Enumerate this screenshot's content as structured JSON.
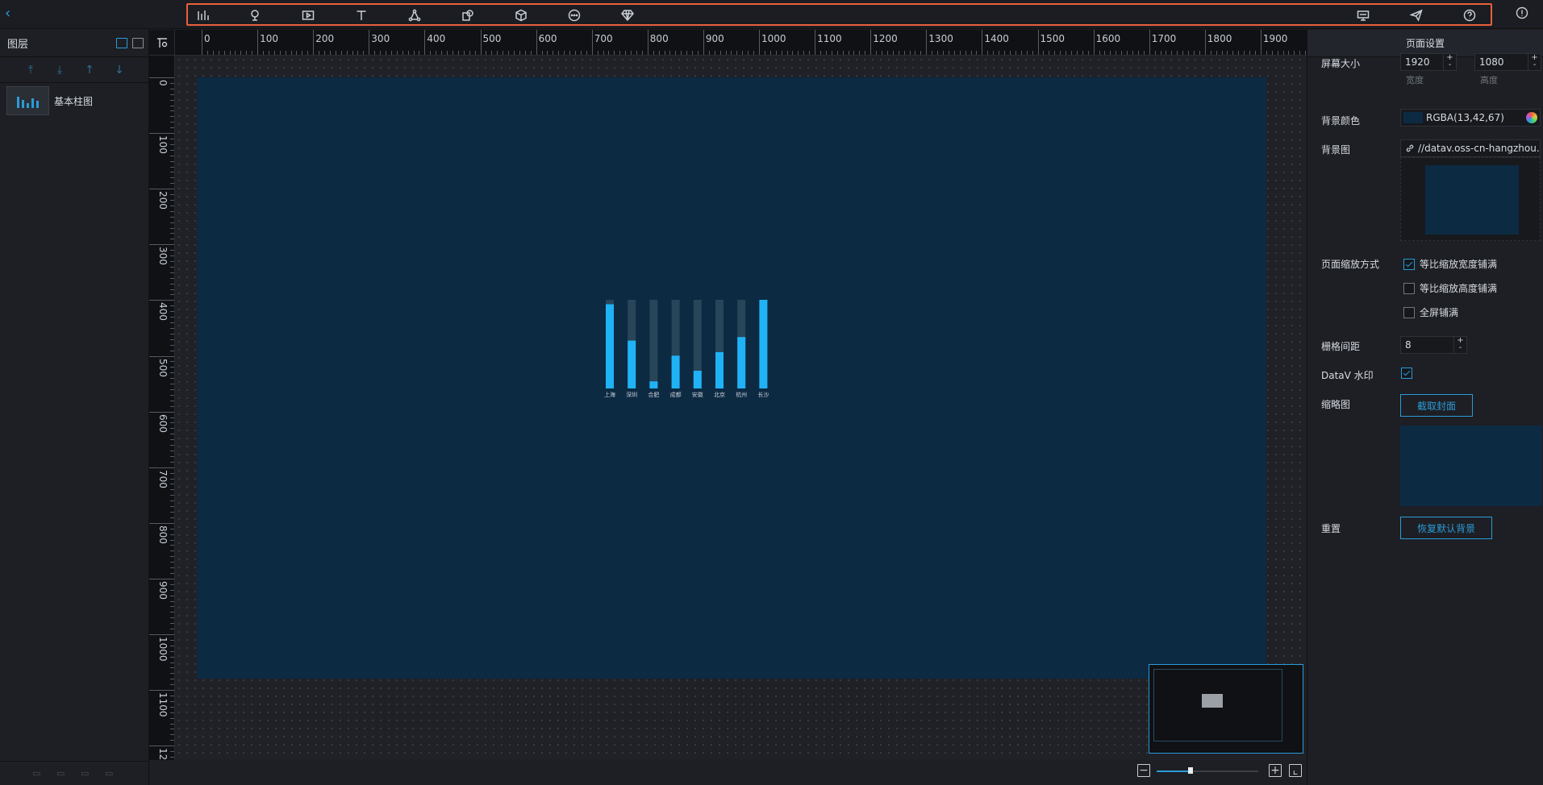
{
  "toolbar": {
    "left_tools": [
      "chart-icon",
      "map-pin-icon",
      "media-icon",
      "text-icon",
      "network-icon",
      "shapes-icon",
      "cube-icon",
      "more-icon",
      "gem-icon"
    ],
    "right_tools": [
      "screen-icon",
      "send-icon",
      "help-icon"
    ]
  },
  "layers": {
    "title": "图层",
    "items": [
      {
        "name": "基本柱图"
      }
    ]
  },
  "ruler": {
    "top_ticks": [
      "0",
      "100",
      "200",
      "300",
      "400",
      "500",
      "600",
      "700",
      "800",
      "900",
      "1000",
      "1100",
      "1200",
      "1300",
      "1400",
      "1500",
      "1600",
      "1700",
      "1800",
      "1900"
    ],
    "left_ticks": [
      "0",
      "100",
      "200",
      "300",
      "400",
      "500",
      "600",
      "700",
      "800",
      "900",
      "1000",
      "1100",
      "12"
    ]
  },
  "settings": {
    "title": "页面设置",
    "screen_size_label": "屏幕大小",
    "width_value": "1920",
    "height_value": "1080",
    "width_sub": "宽度",
    "height_sub": "高度",
    "bg_color_label": "背景颜色",
    "bg_color_value": "RGBA(13,42,67)",
    "bg_color_hex": "#0d2a43",
    "bg_image_label": "背景图",
    "bg_image_value": "//datav.oss-cn-hangzhou.ali",
    "zoom_mode_label": "页面缩放方式",
    "zoom_options": [
      {
        "label": "等比缩放宽度铺满",
        "checked": true
      },
      {
        "label": "等比缩放高度铺满",
        "checked": false
      },
      {
        "label": "全屏铺满",
        "checked": false
      }
    ],
    "grid_spacing_label": "栅格间距",
    "grid_spacing_value": "8",
    "watermark_label": "DataV 水印",
    "watermark_checked": true,
    "thumbnail_label": "缩略图",
    "capture_cover_label": "截取封面",
    "reset_label": "重置",
    "restore_bg_label": "恢复默认背景"
  },
  "colors": {
    "accent": "#2b9bd8",
    "toolbar_highlight": "#e8603c",
    "stage_bg": "#0d2a43",
    "bar_color": "#1fb3f5",
    "bar_track": "#284559"
  },
  "chart_data": {
    "type": "bar",
    "categories": [
      "上海",
      "深圳",
      "合肥",
      "成都",
      "安徽",
      "北京",
      "杭州",
      "长沙"
    ],
    "values": [
      95,
      54,
      8,
      37,
      20,
      41,
      58,
      100
    ],
    "ylim": [
      0,
      100
    ]
  }
}
